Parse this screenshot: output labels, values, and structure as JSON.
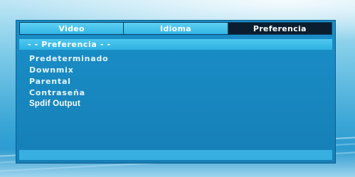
{
  "tabs": [
    {
      "label": "Video",
      "active": false
    },
    {
      "label": "Idioma",
      "active": false
    },
    {
      "label": "Preferencia",
      "active": true
    }
  ],
  "section": {
    "title": "- -  Preferencia  - -"
  },
  "options": [
    {
      "label": "Predeterminado",
      "selected": false
    },
    {
      "label": "Downmix",
      "selected": false
    },
    {
      "label": "Parental",
      "selected": false
    },
    {
      "label": "Contraseña",
      "selected": false
    },
    {
      "label": "Spdif Output",
      "selected": true
    }
  ],
  "colors": {
    "panel": "#1a8fc8",
    "tab_inactive": "#32b6e6",
    "tab_active": "#0a1e2f",
    "section_header": "#2eb1e3",
    "text": "#ffffff"
  }
}
